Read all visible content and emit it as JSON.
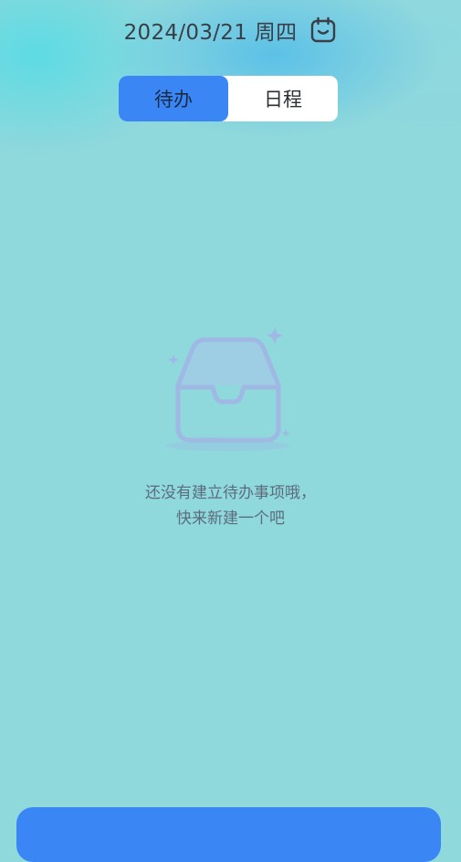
{
  "header": {
    "date": "2024/03/21 周四",
    "calendar_icon": "calendar-icon"
  },
  "tabs": [
    {
      "label": "待办",
      "active": true
    },
    {
      "label": "日程",
      "active": false
    }
  ],
  "empty_state": {
    "icon": "empty-inbox-icon",
    "line1": "还没有建立待办事项哦，",
    "line2": "快来新建一个吧"
  },
  "colors": {
    "accent": "#3a86f5",
    "background": "#8fd8dc",
    "tab_bg": "#ffffff",
    "empty_text": "#5b6d7d",
    "illustration": "#9fb9e4"
  }
}
